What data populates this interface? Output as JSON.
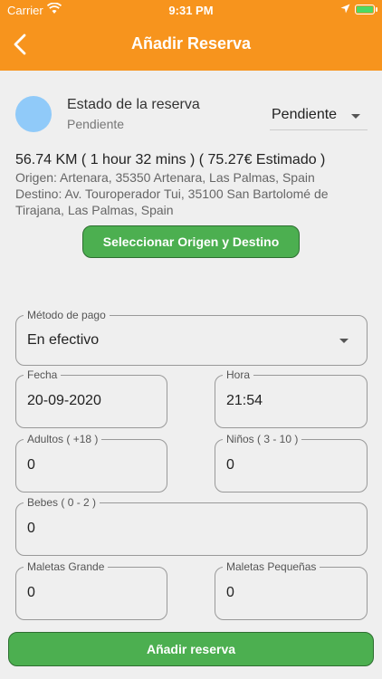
{
  "status_bar": {
    "carrier": "Carrier",
    "time": "9:31 PM"
  },
  "header": {
    "title": "Añadir Reserva"
  },
  "estado": {
    "label": "Estado de la reserva",
    "value": "Pendiente",
    "selected": "Pendiente"
  },
  "route": {
    "summary": "56.74 KM ( 1 hour 32 mins ) ( 75.27€ Estimado  )",
    "origen": "Origen: Artenara, 35350 Artenara, Las Palmas, Spain",
    "destino": "Destino: Av. Touroperador Tui, 35100 San Bartolomé de Tirajana, Las Palmas, Spain",
    "button_label": "Seleccionar Origen y Destino"
  },
  "form": {
    "metodo_pago": {
      "label": "Método de pago",
      "value": "En efectivo"
    },
    "fecha": {
      "label": "Fecha",
      "value": "20-09-2020"
    },
    "hora": {
      "label": "Hora",
      "value": "21:54"
    },
    "adultos": {
      "label": "Adultos ( +18 )",
      "value": "0"
    },
    "ninos": {
      "label": "Niños ( 3 - 10 )",
      "value": "0"
    },
    "bebes": {
      "label": "Bebes ( 0 - 2 )",
      "value": "0"
    },
    "maletas_grande": {
      "label": "Maletas Grande",
      "value": "0"
    },
    "maletas_pequenas": {
      "label": "Maletas Pequeñas",
      "value": "0"
    }
  },
  "submit": {
    "label": "Añadir reserva"
  },
  "colors": {
    "header": "#f7941d",
    "button": "#4caf50",
    "avatar": "#90caf9",
    "background": "#efefef"
  }
}
